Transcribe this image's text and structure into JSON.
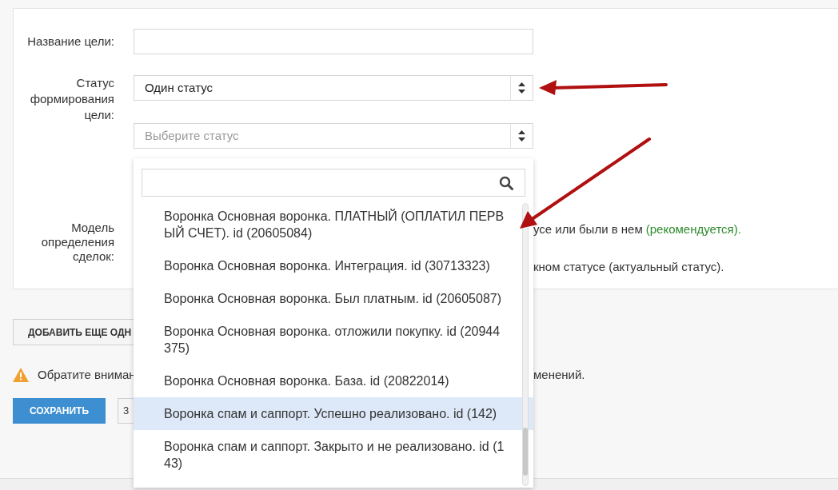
{
  "form": {
    "goal_name": {
      "label": "Название цели:"
    },
    "status_mode": {
      "label": "Статус формирования цели:",
      "value": "Один статус"
    },
    "status_select": {
      "placeholder": "Выберите статус"
    },
    "deal_model": {
      "label": "Модель определения сделок:",
      "option_1_visible": "усе или были в нем",
      "option_1_note": "(рекомендуется).",
      "option_2_visible": "кном статусе (актуальный статус)."
    }
  },
  "add_button": "ДОБАВИТЬ ЕЩЕ ОДН",
  "warning": {
    "text_left": "Обратите вниман",
    "text_right": "менений."
  },
  "save_button": "СОХРАНИТЬ",
  "second_button": "З",
  "dropdown": {
    "options": [
      {
        "label": "Воронка Основная воронка. ПЛАТНЫЙ (ОПЛАТИЛ ПЕРВЫЙ СЧЕТ). id (20605084)",
        "selected": false
      },
      {
        "label": "Воронка Основная воронка. Интеграция. id (30713323)",
        "selected": false
      },
      {
        "label": "Воронка Основная воронка. Был платным. id (20605087)",
        "selected": false
      },
      {
        "label": "Воронка Основная воронка. отложили покупку. id (20944375)",
        "selected": false
      },
      {
        "label": "Воронка Основная воронка. База. id (20822014)",
        "selected": false
      },
      {
        "label": "Воронка спам и саппорт. Успешно реализовано. id (142)",
        "selected": true
      },
      {
        "label": "Воронка спам и саппорт. Закрыто и не реализовано. id (143)",
        "selected": false
      }
    ]
  }
}
